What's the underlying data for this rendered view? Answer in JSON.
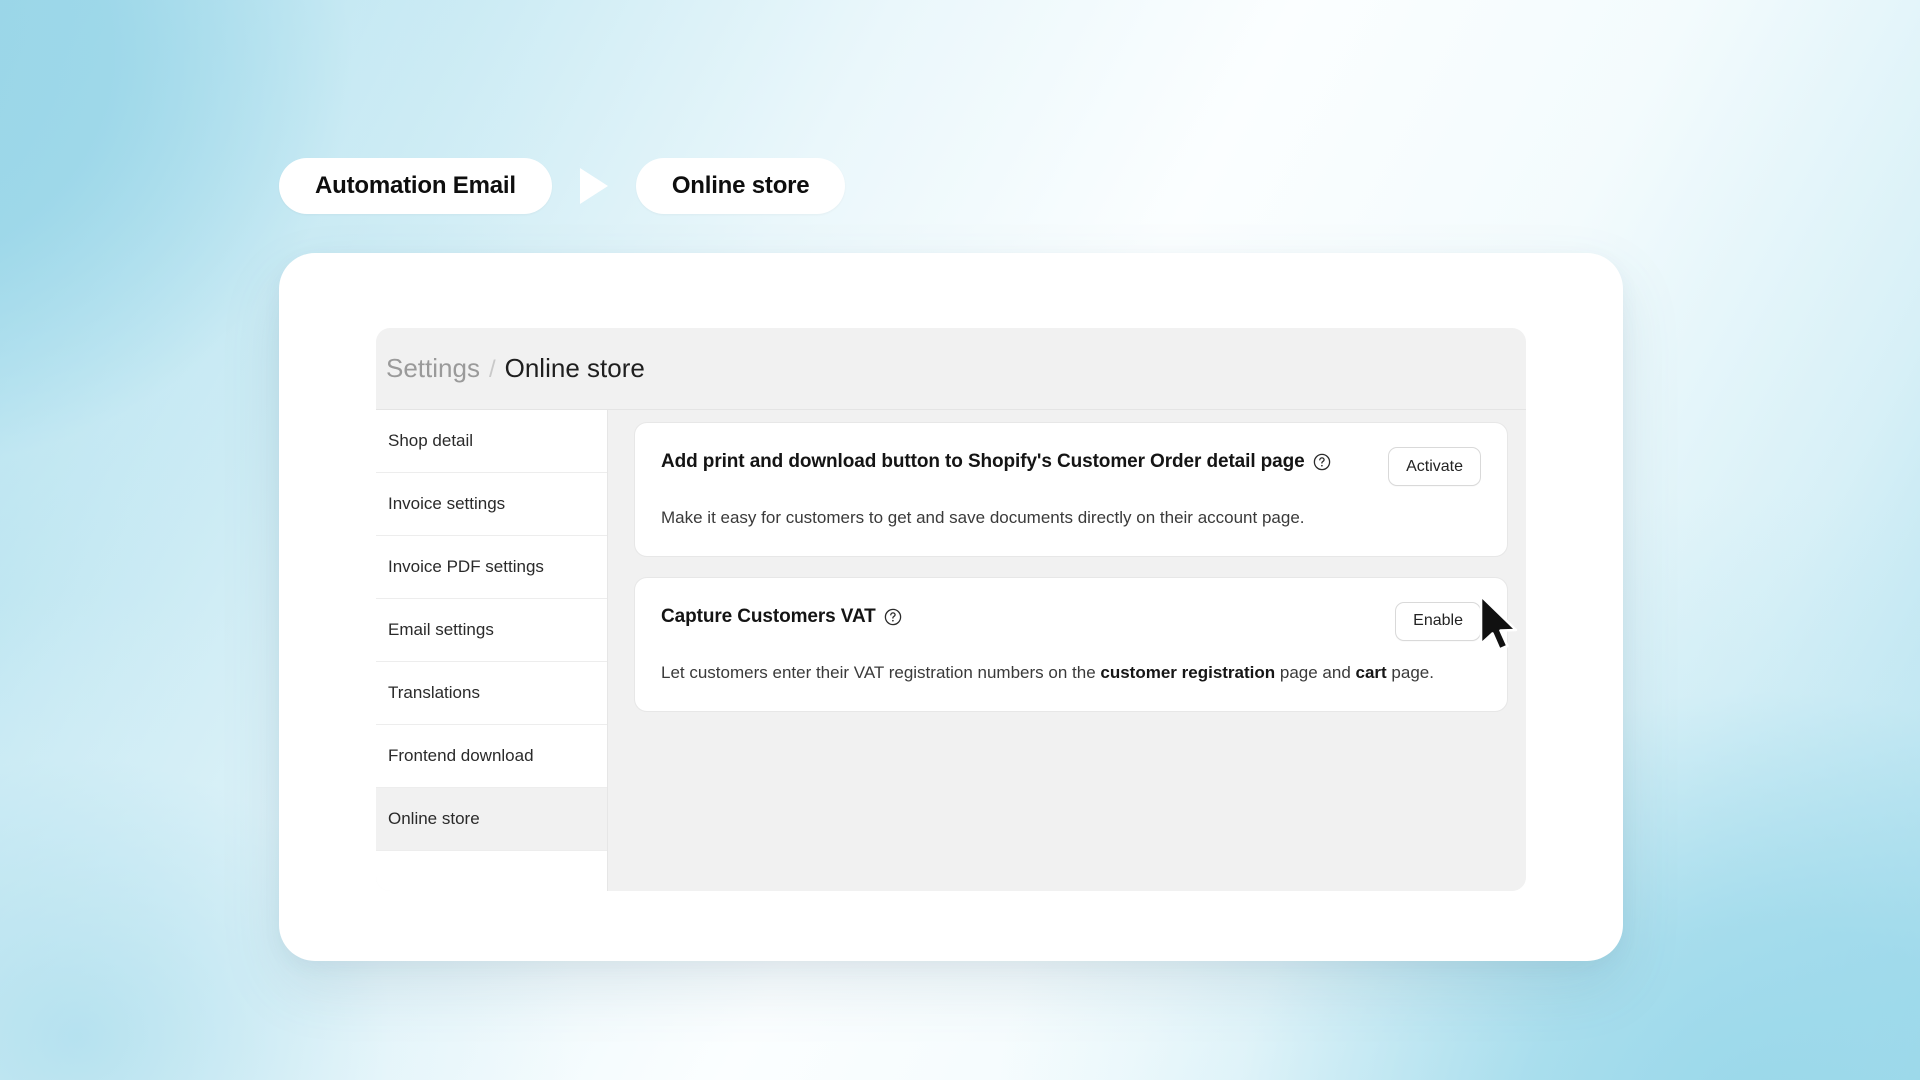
{
  "flow": {
    "step_one": "Automation Email",
    "arrow_icon": "play-triangle-right-icon",
    "step_two": "Online store"
  },
  "panel": {
    "breadcrumb": {
      "parent": "Settings",
      "separator": "/",
      "current": "Online store"
    },
    "sidebar": {
      "items": [
        {
          "label": "Shop detail",
          "selected": false
        },
        {
          "label": "Invoice settings",
          "selected": false
        },
        {
          "label": "Invoice PDF settings",
          "selected": false
        },
        {
          "label": "Email settings",
          "selected": false
        },
        {
          "label": "Translations",
          "selected": false
        },
        {
          "label": "Frontend download",
          "selected": false
        },
        {
          "label": "Online store",
          "selected": true
        }
      ]
    },
    "cards": [
      {
        "title": "Add print and download button to Shopify's Customer Order detail page",
        "help_icon": "question-circle-icon",
        "description": "Make it easy for customers to get and save documents directly on their account page.",
        "button_label": "Activate"
      },
      {
        "title": "Capture Customers VAT",
        "help_icon": "question-circle-icon",
        "description_parts": [
          {
            "text": "Let customers enter their VAT registration numbers on the ",
            "bold": false
          },
          {
            "text": "customer registration",
            "bold": true
          },
          {
            "text": " page and ",
            "bold": false
          },
          {
            "text": "cart",
            "bold": true
          },
          {
            "text": " page.",
            "bold": false
          }
        ],
        "button_label": "Enable"
      }
    ]
  },
  "cursor": {
    "icon": "mouse-pointer-arrow-icon"
  },
  "colors": {
    "background_blue": "#9ad8ea",
    "background_white": "#fbfeff",
    "panel_gray": "#f1f1f1",
    "card_white": "#ffffff",
    "text_primary": "#141414",
    "text_muted": "#9a9a9a"
  }
}
